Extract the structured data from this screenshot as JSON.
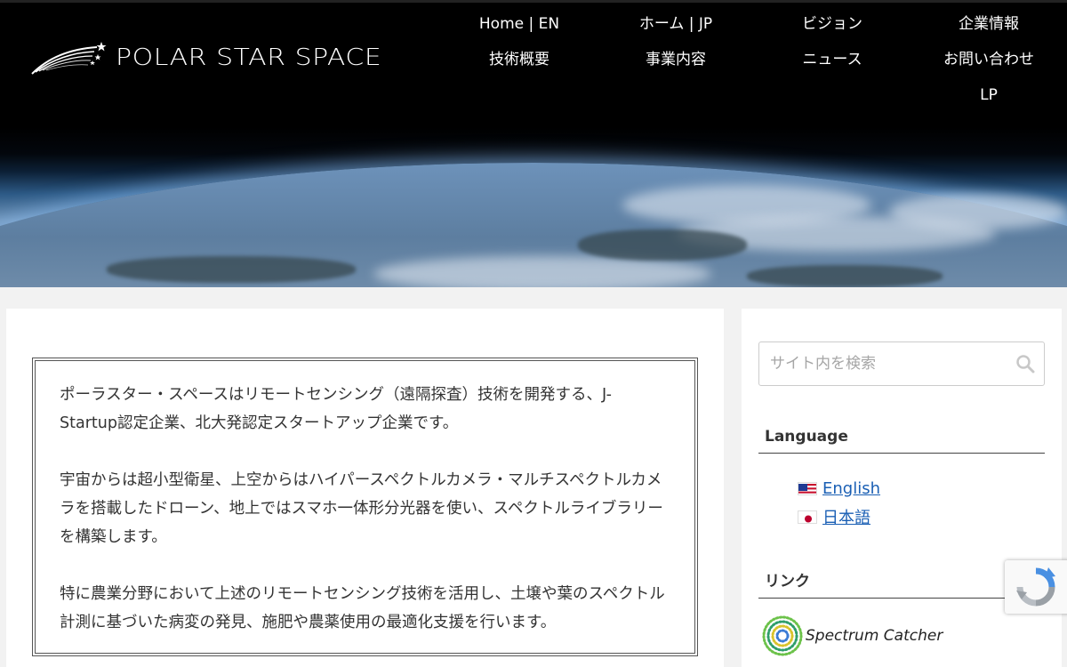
{
  "brand": {
    "name": "POLAR STAR SPACE"
  },
  "nav": {
    "items": [
      {
        "label": "Home | EN"
      },
      {
        "label": "ホーム | JP"
      },
      {
        "label": "ビジョン"
      },
      {
        "label": "企業情報"
      },
      {
        "label": "技術概要"
      },
      {
        "label": "事業内容"
      },
      {
        "label": "ニュース"
      },
      {
        "label": "お問い合わせ"
      },
      {
        "label": "LP"
      }
    ]
  },
  "main": {
    "paragraphs": [
      "ポーラスター・スペースはリモートセンシング（遠隔探査）技術を開発する、J-Startup認定企業、北大発認定スタートアップ企業です。",
      "宇宙からは超小型衛星、上空からはハイパースペクトルカメラ・マルチスペクトルカメラを搭載したドローン、地上ではスマホ一体形分光器を使い、スペクトルライブラリーを構築します。",
      "特に農業分野において上述のリモートセンシング技術を活用し、土壌や葉のスペクトル計測に基づいた病変の発見、施肥や農薬使用の最適化支援を行います。"
    ]
  },
  "sidebar": {
    "search": {
      "placeholder": "サイト内を検索"
    },
    "language": {
      "title": "Language",
      "items": [
        {
          "label": "English",
          "flag": "us-flag-icon"
        },
        {
          "label": "日本語",
          "flag": "jp-flag-icon"
        }
      ]
    },
    "links": {
      "title": "リンク",
      "spectrum_label": "Spectrum Catcher"
    }
  },
  "colors": {
    "link": "#1a5fb4",
    "nav_text": "#ffffff",
    "hero_top": "#000000"
  }
}
